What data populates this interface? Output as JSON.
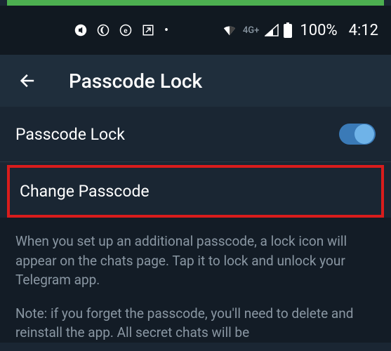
{
  "status_bar": {
    "network_label": "4G+",
    "battery_percent": "100%",
    "time": "4:12"
  },
  "header": {
    "title": "Passcode Lock"
  },
  "settings": {
    "passcode_lock_label": "Passcode Lock",
    "passcode_lock_on": true,
    "change_passcode_label": "Change Passcode"
  },
  "info": {
    "paragraph1": "When you set up an additional passcode, a lock icon will appear on the chats page. Tap it to lock and unlock your Telegram app.",
    "paragraph2": "Note: if you forget the passcode, you'll need to delete and reinstall the app. All secret chats will be"
  }
}
